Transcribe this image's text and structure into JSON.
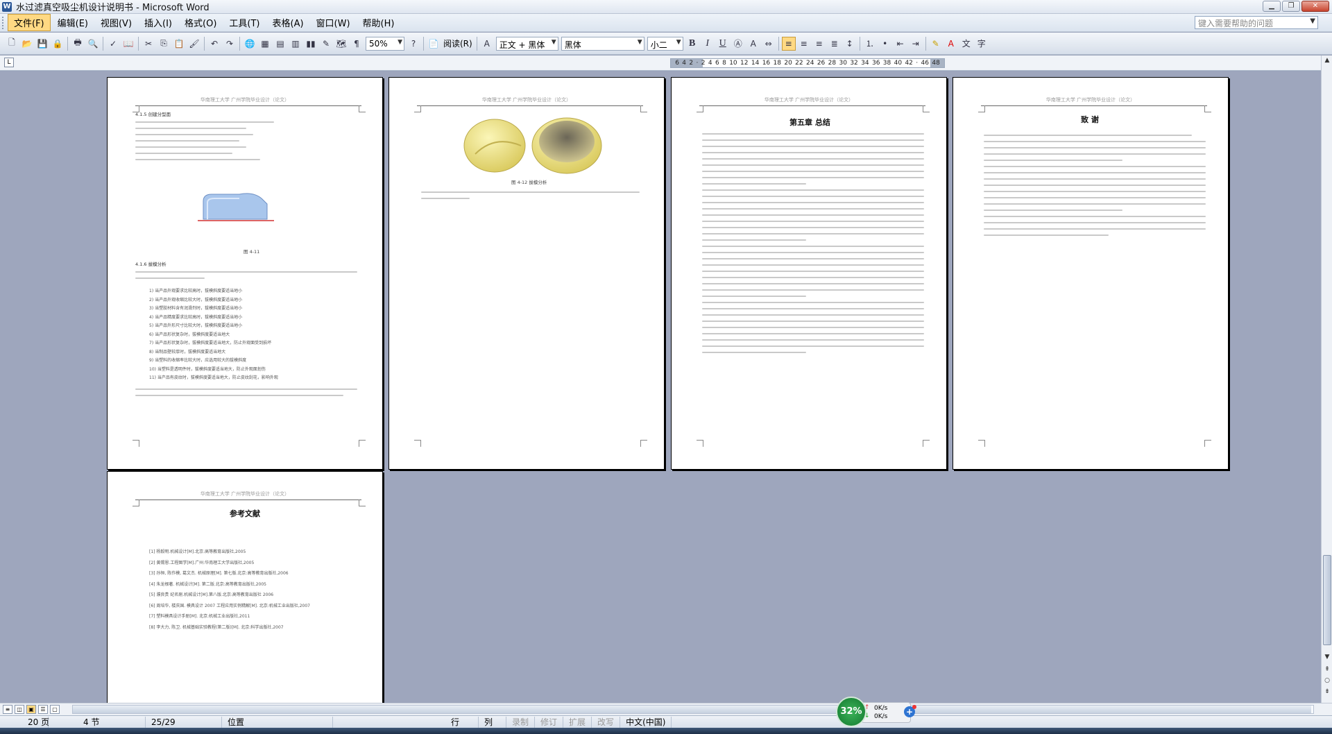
{
  "window": {
    "title": "水过滤真空吸尘机设计说明书 - Microsoft Word"
  },
  "menu": {
    "items": [
      "文件(F)",
      "编辑(E)",
      "视图(V)",
      "插入(I)",
      "格式(O)",
      "工具(T)",
      "表格(A)",
      "窗口(W)",
      "帮助(H)"
    ],
    "help_placeholder": "键入需要帮助的问题"
  },
  "toolbar": {
    "zoom": "50%",
    "read_label": "阅读(R)",
    "style": "正文 + 黑体",
    "font": "黑体",
    "size": "小二"
  },
  "ruler": {
    "ticks": [
      "6",
      "4",
      "2",
      "",
      "2",
      "4",
      "6",
      "8",
      "10",
      "12",
      "14",
      "16",
      "18",
      "20",
      "22",
      "24",
      "26",
      "28",
      "30",
      "32",
      "34",
      "36",
      "38",
      "40",
      "42",
      "",
      "46",
      "48"
    ]
  },
  "pages": {
    "header_text": "华南理工大学  广州学院毕业设计（论文）",
    "p1": {
      "heading1": "4.1.5 创建分型面",
      "caption1": "图 4-11",
      "heading2": "4.1.6 拔模分析",
      "lines": [
        "1)  当产品外观要求比较高时，拔模斜度要适当地小",
        "2)  当产品外观收缩比较大时，拔模斜度要适当地小",
        "3)  当塑胶材料含有润滑剂时，拔模斜度要适当地小",
        "4)  当产品精度要求比较高时，拔模斜度要适当地小",
        "5)  当产品外形尺寸比较大时，拔模斜度要适当地小",
        "6)  当产品形状复杂时，拔模斜度要适当地大",
        "7)  当产品形状复杂时，拔模斜度要适当地大，防止外观面受到损坏",
        "8)  当制品壁较厚时，拔模斜度要适当地大",
        "9)  当塑料的收缩率比较大时，应选用较大的拔模斜度",
        "10) 当塑料是透明件时，拔模斜度要适当地大，防止外观面划伤",
        "11) 当产品有皮纹时，拔模斜度要适当地大，防止皮纹刮花，影响外观"
      ]
    },
    "p2": {
      "caption": "图 4-12 拔模分析"
    },
    "p3": {
      "title": "第五章  总结"
    },
    "p4": {
      "title": "致  谢"
    },
    "p5": {
      "title": "参考文献",
      "refs": [
        "[1] 杨毅明.机械设计[M].北京:高等教育出版社,2005",
        "[2] 黄锡恩.工程图学[M].广州:华南理工大学出版社,2005",
        "[3] 孙桓, 陈作模, 葛文杰. 机械原理[M]. 第七版.北京:高等教育出版社,2006",
        "[4] 朱龙根著. 机械设计[M]. 第二版.北京:高等教育出版社,2005",
        "[5] 濮良贵 纪名刚.机械设计[M].第八版.北京:高等教育出版社 2006",
        "[6] 周培华, 楼庆国. 模具设计 2007 工程应用实例精解[M]. 北京:机械工业出版社,2007",
        "[7] 塑料模具设计手册[M]. 北京:机械工业出版社,2011",
        "[8] 李大力, 陈卫. 机械基础实验教程(第二版)[M]. 北京:科学出版社,2007"
      ]
    }
  },
  "status": {
    "page": "20 页",
    "section": "4 节",
    "pages": "25/29",
    "position": "位置",
    "line": "行",
    "col": "列",
    "rec": "录制",
    "trk": "修订",
    "ext": "扩展",
    "ovr": "改写",
    "lang": "中文(中国)"
  },
  "net_widget": {
    "percent": "32%",
    "up": "0K/s",
    "down": "0K/s"
  }
}
